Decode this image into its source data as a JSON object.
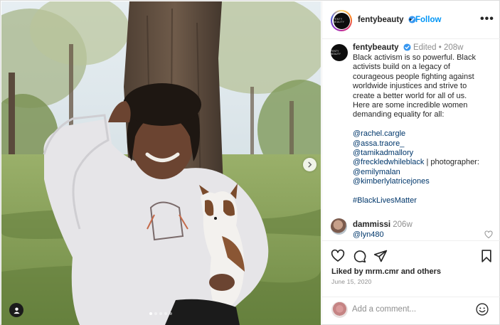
{
  "post": {
    "media": {
      "image_alt": "Woman in a white sweatshirt smiling, holding a brown and white puppy, in front of a tree",
      "carousel_dots": 5,
      "active_dot": 0
    },
    "header": {
      "avatar_text": "FENTY BEAUTY",
      "username": "fentybeauty",
      "separator": "•",
      "follow_label": "Follow",
      "more_label": "•••"
    },
    "caption": {
      "username": "fentybeauty",
      "meta": "Edited • 208w",
      "lines": [
        "Black activism is so powerful. Black",
        "activists build on a legacy of",
        "courageous people fighting against",
        "worldwide injustices and strive to",
        "create a better world for all of us.",
        "Here are some incredible women",
        "demanding equality for all:"
      ],
      "mentions": [
        "@rachel.cargle",
        "@assa.traore_",
        "@tamikadmallory",
        "@freckledwhileblack",
        "@emilymalan",
        "@kimberlylatricejones"
      ],
      "photographer_label": " | photographer:",
      "hashtag": "#BlackLivesMatter"
    },
    "comment": {
      "username": "dammissi",
      "time": "206w",
      "text": "@lyn480"
    },
    "actions": {
      "likes_text": "Liked by mrm.cmr and others",
      "date": "June 15, 2020"
    },
    "add_comment": {
      "placeholder": "Add a comment..."
    }
  },
  "colors": {
    "accent": "#0095f6",
    "mention": "#00376b",
    "muted": "#8e8e8e",
    "text": "#262626",
    "border": "#dbdbdb"
  },
  "icons": [
    "verified-badge-icon",
    "more-icon",
    "chevron-right-icon",
    "user-tag-icon",
    "heart-icon",
    "comment-icon",
    "share-icon",
    "bookmark-icon",
    "emoji-icon"
  ]
}
